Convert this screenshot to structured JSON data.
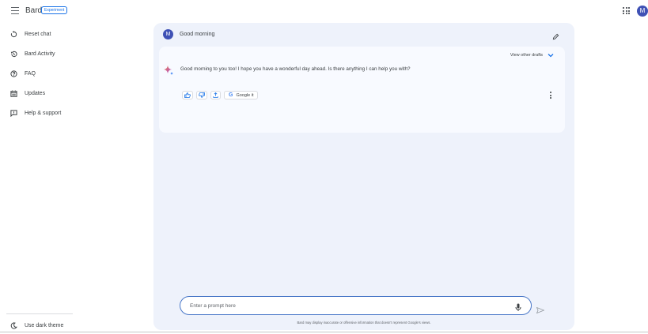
{
  "header": {
    "brand": "Bard",
    "badge": "Experiment",
    "apps_icon": "apps-grid-icon",
    "avatar_letter": "M"
  },
  "sidebar": {
    "items": [
      {
        "label": "Reset chat",
        "icon": "reset-icon"
      },
      {
        "label": "Bard Activity",
        "icon": "history-icon"
      },
      {
        "label": "FAQ",
        "icon": "help-icon"
      },
      {
        "label": "Updates",
        "icon": "calendar-icon"
      },
      {
        "label": "Help & support",
        "icon": "feedback-icon"
      }
    ],
    "dark_theme_label": "Use dark theme"
  },
  "chat": {
    "user_avatar": "M",
    "user_message": "Good morning",
    "view_drafts": "View other drafts",
    "response": "Good morning to you too! I hope you have a wonderful day ahead. Is there anything I can help you with?",
    "google_it": "Google it",
    "prompt_placeholder": "Enter a prompt here",
    "disclaimer": "Bard may display inaccurate or offensive information that doesn't represent Google's views."
  },
  "colors": {
    "accent": "#1a73e8",
    "avatar": "#3f51b5",
    "panel_bg": "#eef2fb"
  }
}
